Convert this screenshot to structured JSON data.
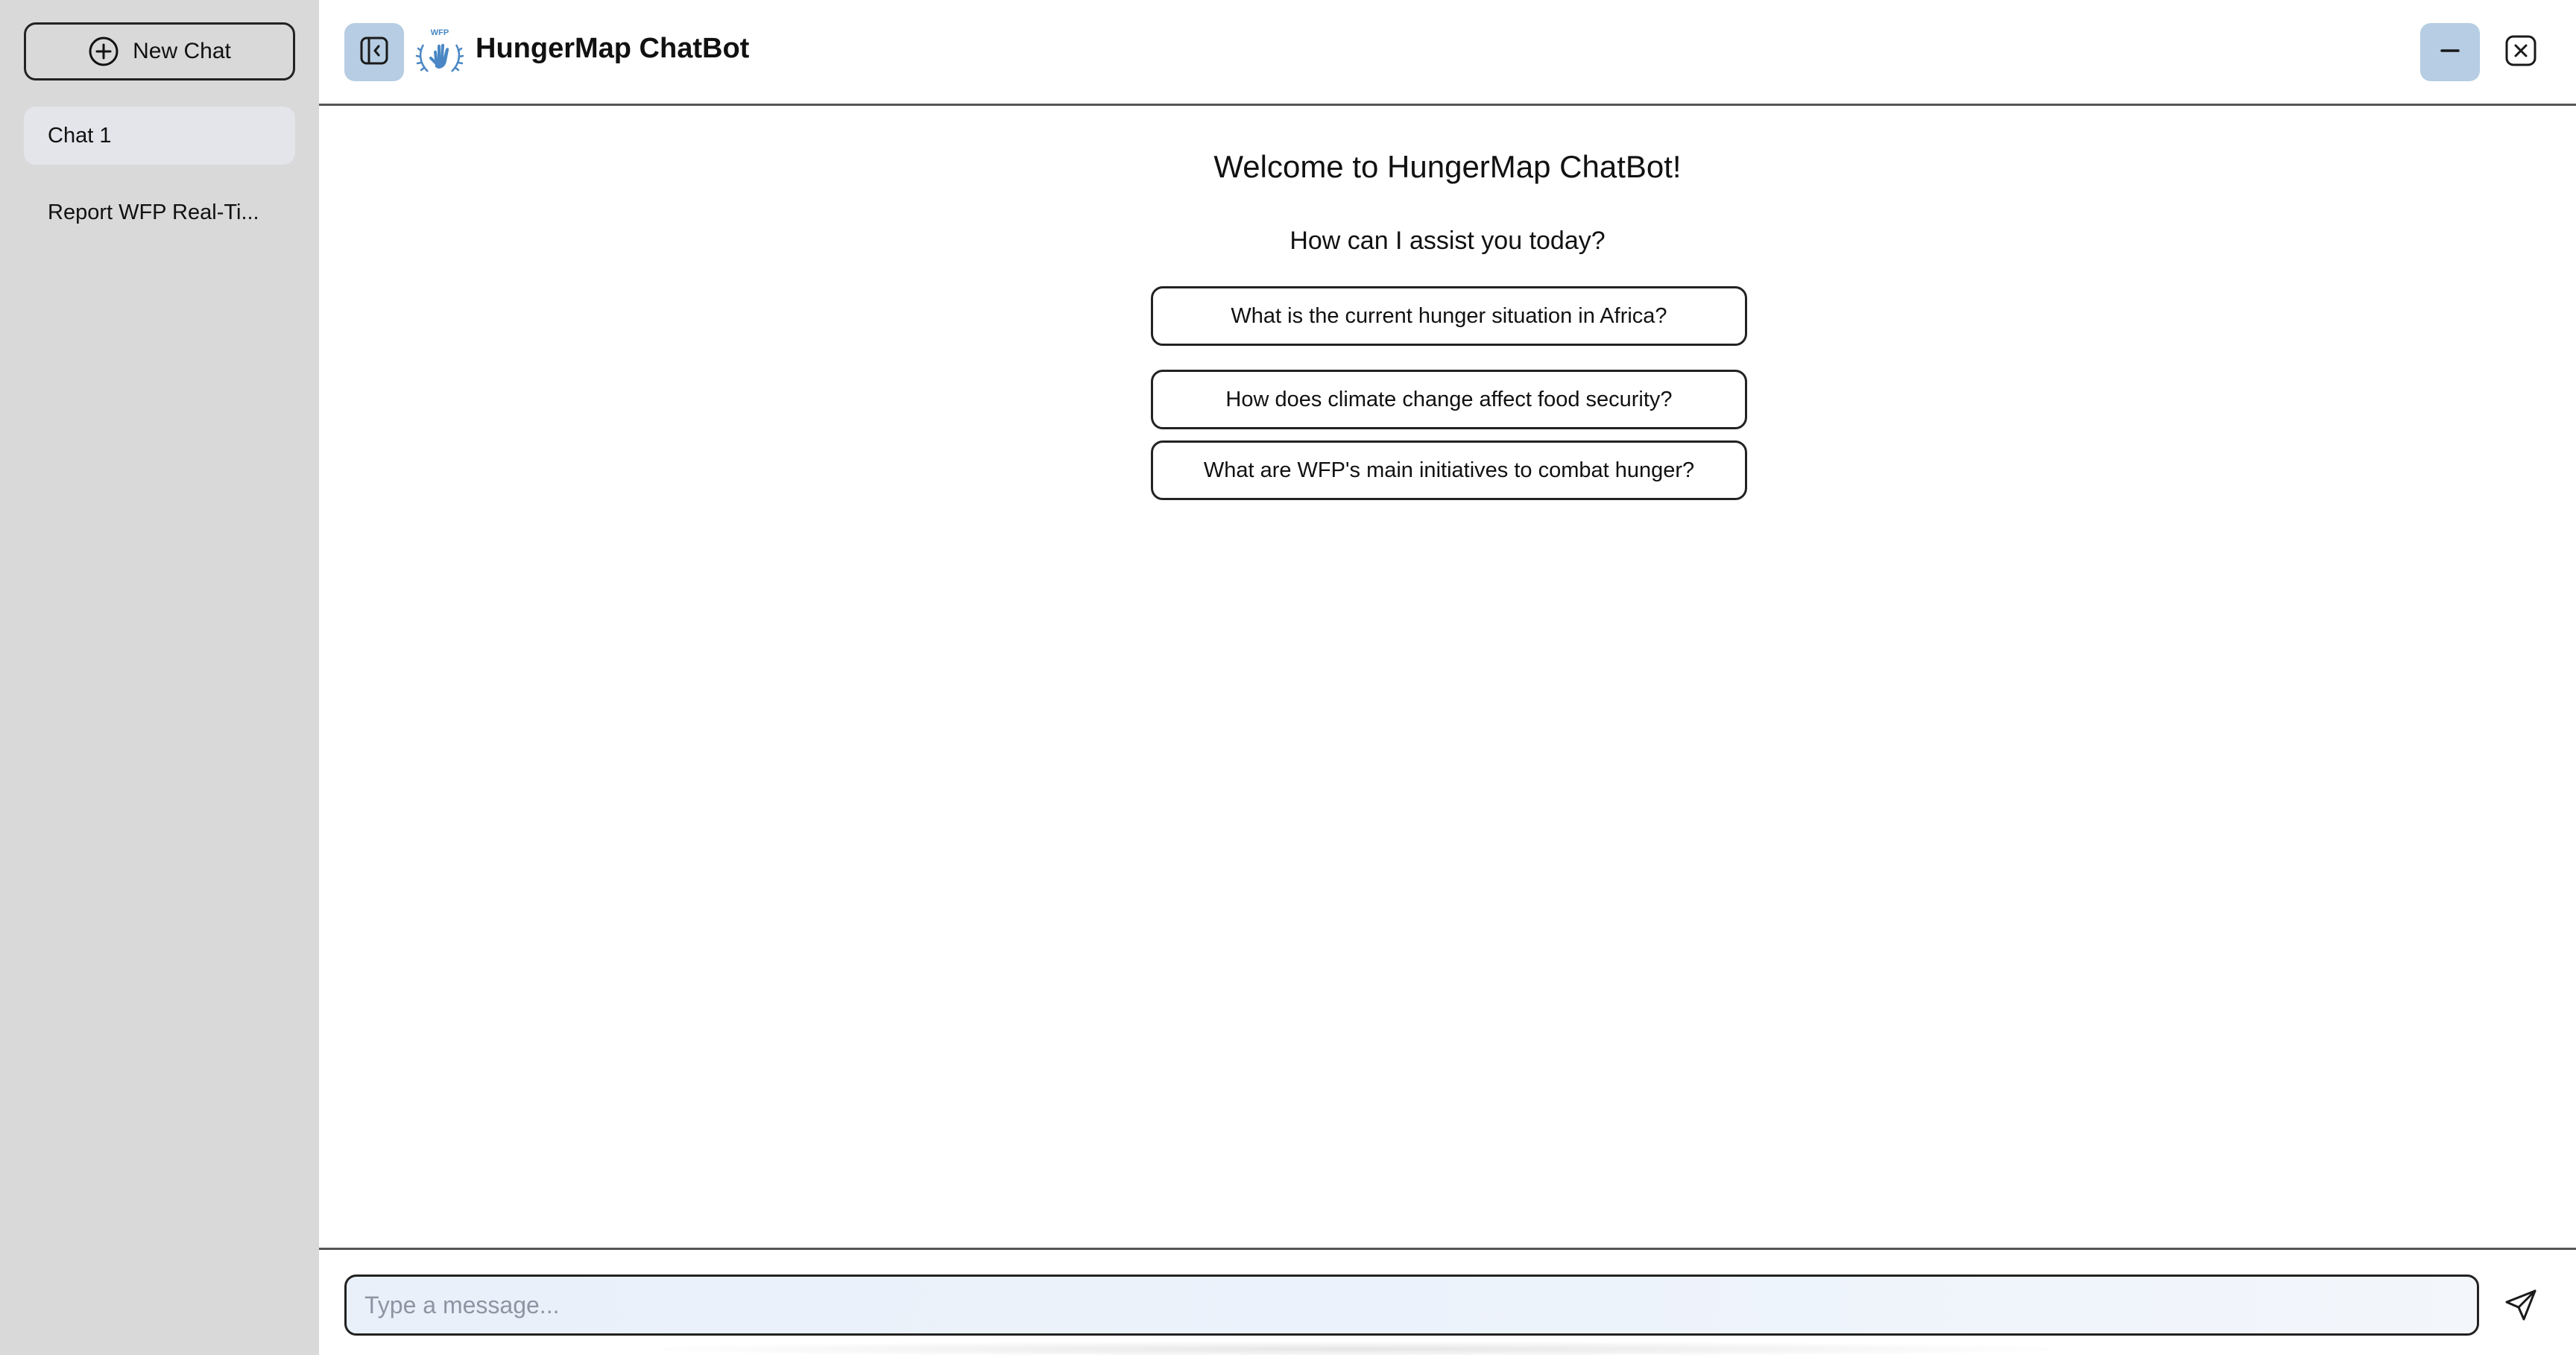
{
  "sidebar": {
    "new_chat_label": "New Chat",
    "chats": [
      {
        "label": "Chat 1",
        "active": true
      },
      {
        "label": "Report WFP Real-Ti...",
        "active": false
      }
    ]
  },
  "header": {
    "title": "HungerMap ChatBot",
    "logo_text": "WFP",
    "collapse_icon": "sidebar-collapse-icon",
    "minimize_icon": "minimize-icon",
    "close_icon": "close-icon"
  },
  "main": {
    "welcome": "Welcome to HungerMap ChatBot!",
    "assist": "How can I assist you today?",
    "suggestions": [
      "What is the current hunger situation in Africa?",
      "How does climate change affect food security?",
      "What are WFP's main initiatives to combat hunger?"
    ]
  },
  "composer": {
    "placeholder": "Type a message...",
    "value": "",
    "send_icon": "send-icon"
  },
  "colors": {
    "sidebar_bg": "#d9d9d9",
    "active_chat_bg": "#e3e5ea",
    "accent_button_bg": "#b6cde3",
    "logo_blue": "#4a87c4"
  }
}
